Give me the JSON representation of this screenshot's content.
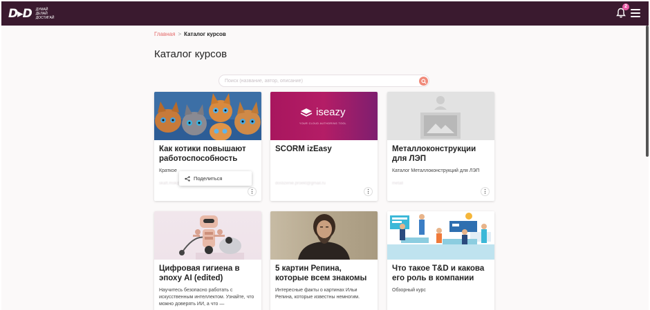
{
  "app": {
    "logo_mark": "D▸D",
    "logo_tagline": [
      "Думай",
      "Делай",
      "Достигай"
    ],
    "notifications_count": "2",
    "brand_color": "#3a1a2f",
    "accent_color": "#f08a7a"
  },
  "breadcrumb": {
    "home": "Главная",
    "separator": ">",
    "current": "Каталог курсов"
  },
  "page": {
    "title": "Каталог курсов"
  },
  "search": {
    "placeholder": "Поиск (название, автор, описание)",
    "value": ""
  },
  "share_menu": {
    "label": "Поделиться"
  },
  "courses": [
    {
      "title": "Как котики повышают работоспособность",
      "description": "Краткое",
      "author": "skaft.msk@ddd.ru",
      "image": "kittens"
    },
    {
      "title": "SCORM izEasy",
      "description": "",
      "author": "dostizenie.proekt@gmail.ru",
      "image": "iseazy-banner",
      "image_brand": "iseazy",
      "image_sub": "YOUR CLOUD AUTHORING TOOL"
    },
    {
      "title": "Металлоконструкции для ЛЭП",
      "description": "Каталог Металлоконструкций для ЛЭП",
      "author": "metall",
      "image": "placeholder"
    },
    {
      "title": "Цифровая гигиена в эпоху AI (edited)",
      "description": "Научитесь безопасно работать с искусственным интеллектом. Узнайте, что можно доверять ИИ, а что —",
      "author": "",
      "image": "robot"
    },
    {
      "title": "5 картин Репина, которые всем знакомы",
      "description": "Интересные факты о картинах Ильи Репина, которые известны немногим.",
      "author": "",
      "image": "portrait"
    },
    {
      "title": "Что такое T&D и какова его роль в компании",
      "description": "Обзорный курс",
      "author": "",
      "image": "team"
    }
  ]
}
